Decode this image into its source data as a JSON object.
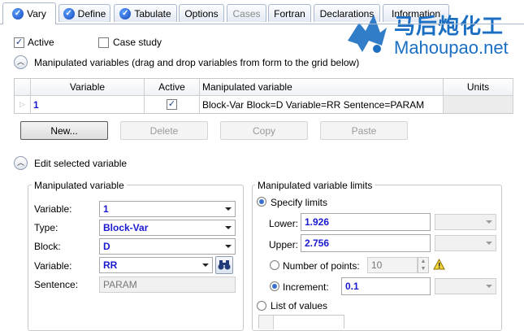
{
  "tabs": [
    {
      "label": "Vary",
      "icon": "check-circle-icon"
    },
    {
      "label": "Define",
      "icon": "check-circle-icon"
    },
    {
      "label": "Tabulate",
      "icon": "check-circle-icon"
    },
    {
      "label": "Options"
    },
    {
      "label": "Cases"
    },
    {
      "label": "Fortran"
    },
    {
      "label": "Declarations"
    },
    {
      "label": "Information"
    }
  ],
  "watermark": {
    "cn": "马后炮化工",
    "en": "Mahoupao.net"
  },
  "active_label": "Active",
  "case_study_label": "Case study",
  "manip_section_title": "Manipulated variables (drag and drop variables from form to the grid below)",
  "grid": {
    "headers": [
      "Variable",
      "Active",
      "Manipulated variable",
      "Units"
    ],
    "rows": [
      {
        "variable": "1",
        "active_checked": true,
        "manipulated": "Block-Var Block=D Variable=RR Sentence=PARAM",
        "units": ""
      }
    ]
  },
  "buttons": {
    "new": "New...",
    "delete": "Delete",
    "copy": "Copy",
    "paste": "Paste"
  },
  "edit_section_title": "Edit selected variable",
  "manip_var_group": {
    "title": "Manipulated variable",
    "variable_label": "Variable:",
    "variable_value": "1",
    "type_label": "Type:",
    "type_value": "Block-Var",
    "block_label": "Block:",
    "block_value": "D",
    "variable2_label": "Variable:",
    "variable2_value": "RR",
    "sentence_label": "Sentence:",
    "sentence_value": "PARAM"
  },
  "limits_group": {
    "title": "Manipulated variable limits",
    "specify_label": "Specify limits",
    "lower_label": "Lower:",
    "lower_value": "1.926",
    "upper_label": "Upper:",
    "upper_value": "2.756",
    "num_points_label": "Number of points:",
    "num_points_value": "10",
    "increment_label": "Increment:",
    "increment_value": "0.1",
    "list_label": "List of values"
  },
  "colors": {
    "accent": "#1a1ad0",
    "tab_border": "#a9b8cf",
    "watermark": "#1b6fc2"
  }
}
